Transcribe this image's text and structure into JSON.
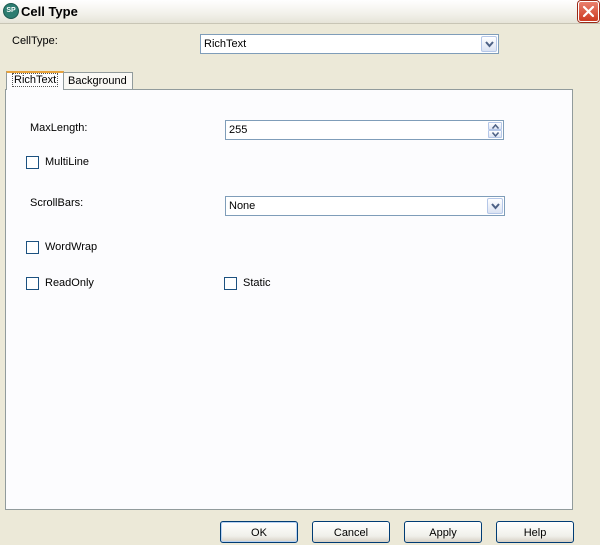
{
  "window": {
    "title": "Cell Type",
    "app_icon_text": "SP"
  },
  "celltype": {
    "label": "CellType:",
    "selected": "RichText"
  },
  "tabs": [
    {
      "label": "RichText",
      "active": true
    },
    {
      "label": "Background",
      "active": false
    }
  ],
  "richtext": {
    "maxlength_label": "MaxLength:",
    "maxlength_value": "255",
    "multiline_label": "MultiLine",
    "scrollbars_label": "ScrollBars:",
    "scrollbars_value": "None",
    "wordwrap_label": "WordWrap",
    "readonly_label": "ReadOnly",
    "static_label": "Static"
  },
  "buttons": {
    "ok": "OK",
    "cancel": "Cancel",
    "apply": "Apply",
    "help": "Help"
  },
  "colors": {
    "accent_tab": "#e8a33c",
    "border_blue": "#7f9db9",
    "close_red": "#cd3a22"
  }
}
